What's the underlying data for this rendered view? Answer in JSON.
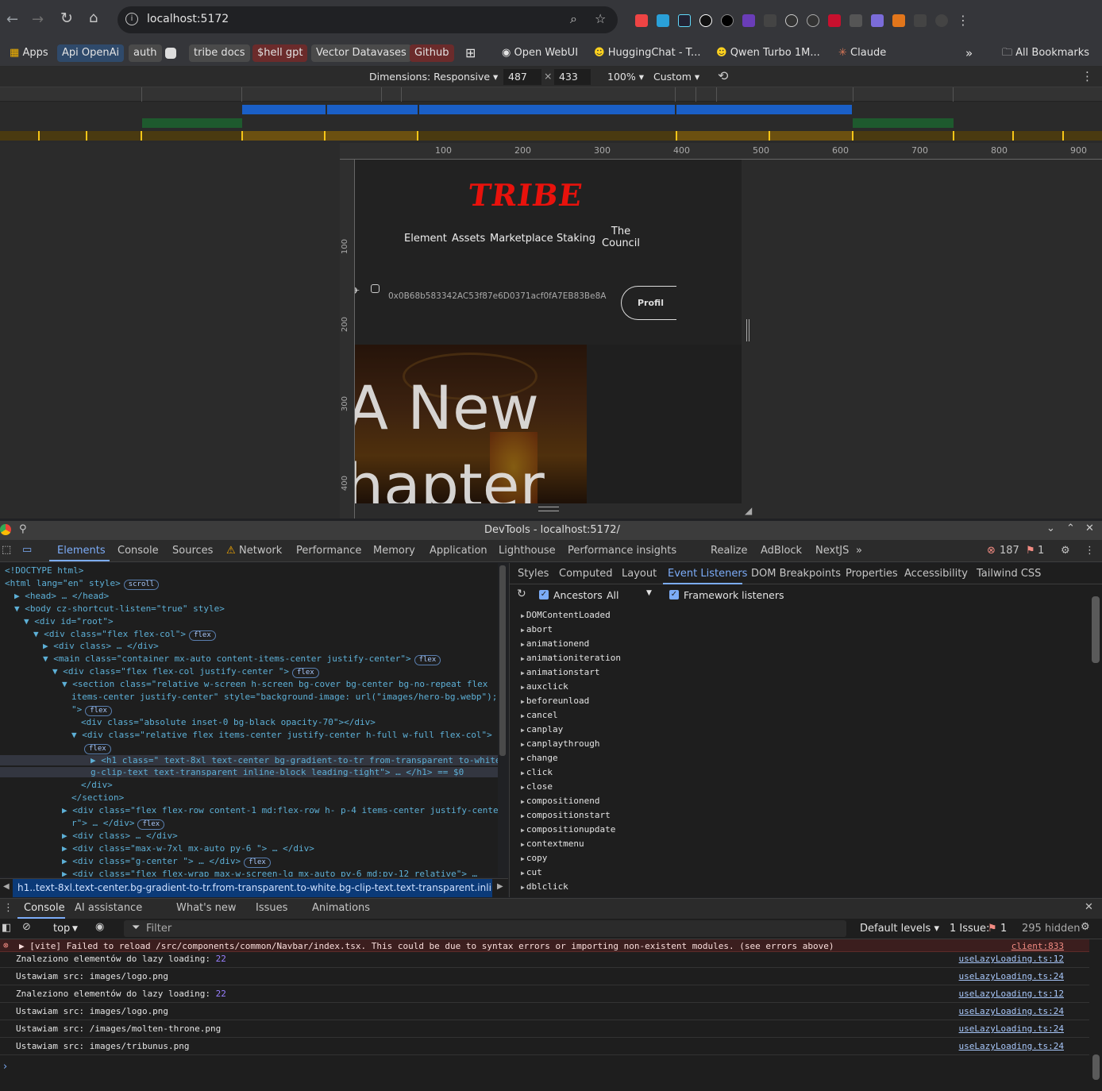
{
  "browser": {
    "url": "localhost:5172"
  },
  "bookmarks": [
    {
      "label": "Apps",
      "style": "plain"
    },
    {
      "label": "Api OpenAi",
      "style": "blue"
    },
    {
      "label": "auth",
      "style": "chip"
    },
    {
      "label": "tribe docs",
      "style": "chip"
    },
    {
      "label": "$hell gpt",
      "style": "red"
    },
    {
      "label": "Vector Datavases",
      "style": "chip"
    },
    {
      "label": "Github",
      "style": "red"
    },
    {
      "label": "Open WebUI",
      "style": "plain"
    },
    {
      "label": "HuggingChat - T...",
      "style": "plain"
    },
    {
      "label": "Qwen Turbo 1M...",
      "style": "plain"
    },
    {
      "label": "Claude",
      "style": "plain"
    },
    {
      "label": "All Bookmarks",
      "style": "plain"
    }
  ],
  "device_toolbar": {
    "dimensions": "Dimensions: Responsive ▾",
    "width": "487",
    "height": "433",
    "zoom": "100% ▾",
    "throttle": "Custom ▾"
  },
  "ruler": {
    "ticks": [
      "100",
      "200",
      "300",
      "400",
      "500",
      "600",
      "700",
      "800",
      "900"
    ],
    "vticks": [
      "100",
      "200",
      "300",
      "400"
    ]
  },
  "site": {
    "logo": "TRIBE",
    "nav": [
      "Element",
      "Assets",
      "Marketplace",
      "Staking"
    ],
    "nav_council_1": "The",
    "nav_council_2": "Council",
    "wallet": "0x0B68b583342AC53f87e6D0371acf0fA7EB83Be8A",
    "profile": "Profil",
    "hero_line1": "A New",
    "hero_line2": "hapter"
  },
  "devtools": {
    "title": "DevTools - localhost:5172/",
    "tabs": [
      "Elements",
      "Console",
      "Sources",
      "Network",
      "Performance",
      "Memory",
      "Application",
      "Lighthouse",
      "Performance insights",
      "Realize",
      "AdBlock",
      "NextJS"
    ],
    "errors": "187",
    "warnings": "1",
    "breadcrumb": "h1..text-8xl.text-center.bg-gradient-to-tr.from-transparent.to-white.bg-clip-text.text-transparent.inline-bloc",
    "dom": [
      {
        "i": 0,
        "html": "<!DOCTYPE html>"
      },
      {
        "i": 0,
        "html": "<html lang=\"en\" style>",
        "badge": "scroll"
      },
      {
        "i": 1,
        "html": "▶ <head> … </head>"
      },
      {
        "i": 1,
        "html": "▼ <body cz-shortcut-listen=\"true\" style>"
      },
      {
        "i": 2,
        "html": "▼ <div id=\"root\">"
      },
      {
        "i": 3,
        "html": "▼ <div class=\"flex flex-col\">",
        "badge": "flex"
      },
      {
        "i": 4,
        "html": "▶ <div class> … </div>"
      },
      {
        "i": 4,
        "html": "▼ <main class=\"container mx-auto content-items-center justify-center\">",
        "badge": "flex"
      },
      {
        "i": 5,
        "html": "▼ <div class=\"flex flex-col justify-center  \">",
        "badge": "flex"
      },
      {
        "i": 6,
        "html": "▼ <section class=\"relative w-screen   h-screen bg-cover  bg-center bg-no-repeat flex"
      },
      {
        "i": 7,
        "html": "items-center justify-center\" style=\"background-image: url(\"images/hero-bg.webp\");"
      },
      {
        "i": 7,
        "html": "\">",
        "badge": "flex"
      },
      {
        "i": 8,
        "html": "<div class=\"absolute inset-0 bg-black opacity-70\"></div>"
      },
      {
        "i": 7,
        "html": "▼ <div class=\"relative flex items-center justify-center h-full w-full flex-col\">"
      },
      {
        "i": 8,
        "html": "",
        "badge": "flex"
      },
      {
        "i": 9,
        "html": "▶ <h1 class=\"  text-8xl text-center bg-gradient-to-tr from-transparent to-white b",
        "sel": true
      },
      {
        "i": 9,
        "html": "g-clip-text text-transparent inline-block leading-tight\"> … </h1> == $0",
        "sel": true
      },
      {
        "i": 8,
        "html": "</div>"
      },
      {
        "i": 7,
        "html": "</section>"
      },
      {
        "i": 6,
        "html": "▶ <div class=\"flex flex-row  content-1 md:flex-row h- p-4 items-center justify-cente"
      },
      {
        "i": 7,
        "html": "r\"> … </div>",
        "badge": "flex"
      },
      {
        "i": 6,
        "html": "▶ <div class> … </div>"
      },
      {
        "i": 6,
        "html": "▶ <div class=\"max-w-7xl mx-auto py-6 \"> … </div>"
      },
      {
        "i": 6,
        "html": "▶ <div class=\"g-center \"> … </div>",
        "badge": "flex"
      },
      {
        "i": 6,
        "html": "▶ <div class=\"flex flex-wrap max-w-screen-lg mx-auto py-6 md:py-12 relative\"> …"
      }
    ],
    "side_tabs": [
      "Styles",
      "Computed",
      "Layout",
      "Event Listeners",
      "DOM Breakpoints",
      "Properties",
      "Accessibility",
      "Tailwind CSS"
    ],
    "ancestors": "Ancestors",
    "all": "All",
    "framework": "Framework listeners",
    "events": [
      "DOMContentLoaded",
      "abort",
      "animationend",
      "animationiteration",
      "animationstart",
      "auxclick",
      "beforeunload",
      "cancel",
      "canplay",
      "canplaythrough",
      "change",
      "click",
      "close",
      "compositionend",
      "compositionstart",
      "compositionupdate",
      "contextmenu",
      "copy",
      "cut",
      "dblclick"
    ],
    "drawer_tabs": [
      "Console",
      "AI assistance",
      "What's new",
      "Issues",
      "Animations"
    ],
    "console_bar": {
      "context": "top",
      "filter": "Filter",
      "levels": "Default levels ▾",
      "issues": "1 Issue:",
      "issue_count": "1",
      "hidden": "295 hidden"
    },
    "logs": [
      {
        "type": "error",
        "text": "▶ [vite] Failed to reload /src/components/common/Navbar/index.tsx. This could be due to syntax errors or importing non-existent modules. (see errors above)",
        "src": "client:833"
      },
      {
        "type": "log",
        "text": "Znaleziono elementów do lazy loading: ",
        "num": "22",
        "src": "useLazyLoading.ts:12"
      },
      {
        "type": "log",
        "text": "Ustawiam src: images/logo.png",
        "src": "useLazyLoading.ts:24"
      },
      {
        "type": "log",
        "text": "Znaleziono elementów do lazy loading: ",
        "num": "22",
        "src": "useLazyLoading.ts:12"
      },
      {
        "type": "log",
        "text": "Ustawiam src: images/logo.png",
        "src": "useLazyLoading.ts:24"
      },
      {
        "type": "log",
        "text": "Ustawiam src: /images/molten-throne.png",
        "src": "useLazyLoading.ts:24"
      },
      {
        "type": "log",
        "text": "Ustawiam src: images/tribunus.png",
        "src": "useLazyLoading.ts:24"
      }
    ]
  }
}
